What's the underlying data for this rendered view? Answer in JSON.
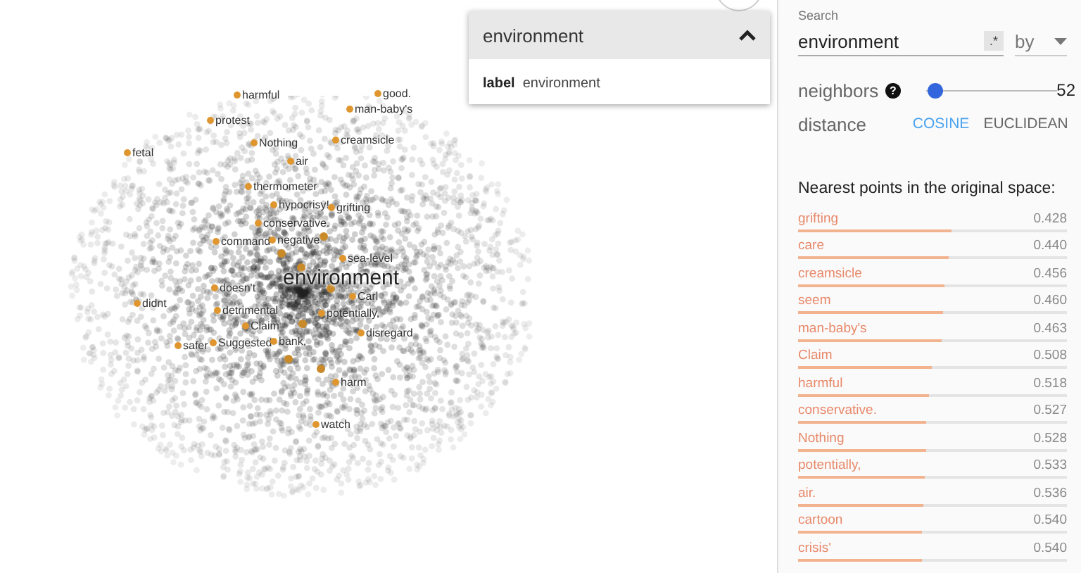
{
  "labels": [
    {
      "text": "harmful",
      "kind": "point"
    },
    {
      "text": "good.",
      "kind": "point"
    },
    {
      "text": "man-baby's",
      "kind": "point"
    },
    {
      "text": "protest",
      "kind": "point"
    },
    {
      "text": "Nothing",
      "kind": "point"
    },
    {
      "text": "creamsicle",
      "kind": "point"
    },
    {
      "text": "fetal",
      "kind": "point"
    },
    {
      "text": "air",
      "kind": "point"
    },
    {
      "text": "thermometer",
      "kind": "point"
    },
    {
      "text": "hypocrisy!",
      "kind": "point"
    },
    {
      "text": "grifting",
      "kind": "point"
    },
    {
      "text": "conservative.",
      "kind": "point"
    },
    {
      "text": "command",
      "kind": "point"
    },
    {
      "text": "negative",
      "kind": "point"
    },
    {
      "text": "sea-level",
      "kind": "point"
    },
    {
      "text": "environment",
      "kind": "focus"
    },
    {
      "text": "doesn't",
      "kind": "point"
    },
    {
      "text": "Carl",
      "kind": "point"
    },
    {
      "text": "didnt",
      "kind": "point"
    },
    {
      "text": "detrimental",
      "kind": "point"
    },
    {
      "text": "potentially,",
      "kind": "point"
    },
    {
      "text": "Claim",
      "kind": "point"
    },
    {
      "text": "disregard",
      "kind": "point"
    },
    {
      "text": "safer",
      "kind": "point"
    },
    {
      "text": "Suggested",
      "kind": "point"
    },
    {
      "text": "bank,",
      "kind": "point"
    },
    {
      "text": "harm",
      "kind": "point"
    },
    {
      "text": "watch",
      "kind": "point"
    }
  ],
  "card": {
    "title": "environment",
    "expanded": true,
    "key": "label",
    "value": "environment"
  },
  "search": {
    "label": "Search",
    "value": "environment",
    "regex_toggle": ".*",
    "by": "by"
  },
  "neighbors": {
    "label": "neighbors",
    "help": "?",
    "level": 0.02,
    "value": "52"
  },
  "distance": {
    "label": "distance",
    "options": [
      {
        "label": "COSINE",
        "selected": true
      },
      {
        "label": "EUCLIDEAN",
        "selected": false
      }
    ]
  },
  "nearest": {
    "title": "Nearest points in the original space:",
    "rows": [
      {
        "word": "grifting",
        "value": "0.428",
        "level": 0.57
      },
      {
        "word": "care",
        "value": "0.440",
        "level": 0.56
      },
      {
        "word": "creamsicle",
        "value": "0.456",
        "level": 0.545
      },
      {
        "word": "seem",
        "value": "0.460",
        "level": 0.54
      },
      {
        "word": "man-baby's",
        "value": "0.463",
        "level": 0.535
      },
      {
        "word": "Claim",
        "value": "0.508",
        "level": 0.495
      },
      {
        "word": "harmful",
        "value": "0.518",
        "level": 0.485
      },
      {
        "word": "conservative.",
        "value": "0.527",
        "level": 0.475
      },
      {
        "word": "Nothing",
        "value": "0.528",
        "level": 0.475
      },
      {
        "word": "potentially,",
        "value": "0.533",
        "level": 0.47
      },
      {
        "word": "air.",
        "value": "0.536",
        "level": 0.465
      },
      {
        "word": "cartoon",
        "value": "0.540",
        "level": 0.46
      },
      {
        "word": "crisis'",
        "value": "0.540",
        "level": 0.46
      }
    ]
  }
}
